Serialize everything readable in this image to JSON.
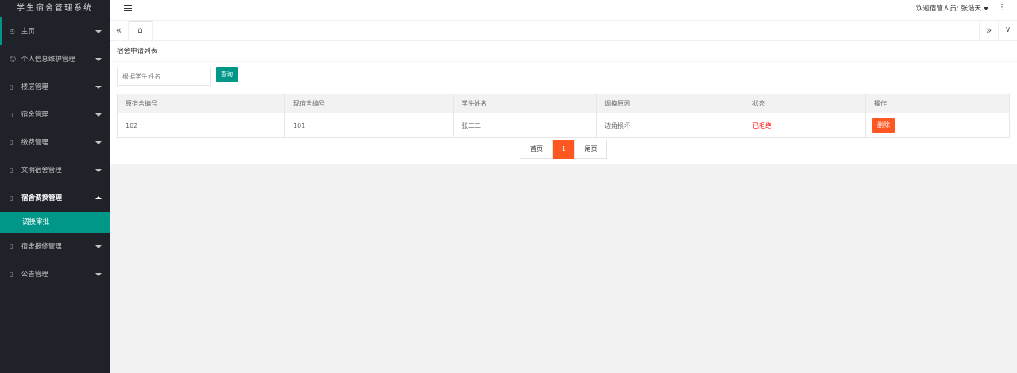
{
  "app": {
    "title": "学生宿舍管理系统"
  },
  "header": {
    "welcome": "欢迎宿管人员: 张浩天",
    "more_glyph": "⋮"
  },
  "sidebar": {
    "items": [
      {
        "label": "主页",
        "icon": "dashboard-icon"
      },
      {
        "label": "个人信息维护管理",
        "icon": "user-icon"
      },
      {
        "label": "楼层管理",
        "icon": "document-icon"
      },
      {
        "label": "宿舍管理",
        "icon": "document-icon"
      },
      {
        "label": "缴费管理",
        "icon": "document-icon"
      },
      {
        "label": "文明宿舍管理",
        "icon": "document-icon"
      },
      {
        "label": "宿舍调换管理",
        "icon": "document-icon"
      },
      {
        "label": "宿舍报修管理",
        "icon": "document-icon"
      },
      {
        "label": "公告管理",
        "icon": "document-icon"
      }
    ],
    "sub_item": {
      "label": "调换审批"
    }
  },
  "tabs": {
    "left_glyph": "«",
    "home_glyph": "⌂",
    "right_glyph": "»",
    "down_glyph": "∨"
  },
  "main": {
    "card_title": "宿舍申请列表",
    "search": {
      "placeholder": "根据学生姓名",
      "button": "查询"
    },
    "table": {
      "headers": [
        "原宿舍编号",
        "现宿舍编号",
        "学生姓名",
        "调换原因",
        "状态",
        "操作"
      ],
      "rows": [
        {
          "old_room": "102",
          "new_room": "101",
          "student": "张二二",
          "reason": "边角损坏",
          "status": "已拒绝",
          "action": "删除"
        }
      ]
    },
    "pager": {
      "first": "首页",
      "current": "1",
      "last": "尾页"
    }
  },
  "colors": {
    "accent": "#009688",
    "danger": "#ff5722",
    "sidebar_bg": "#20222a"
  }
}
